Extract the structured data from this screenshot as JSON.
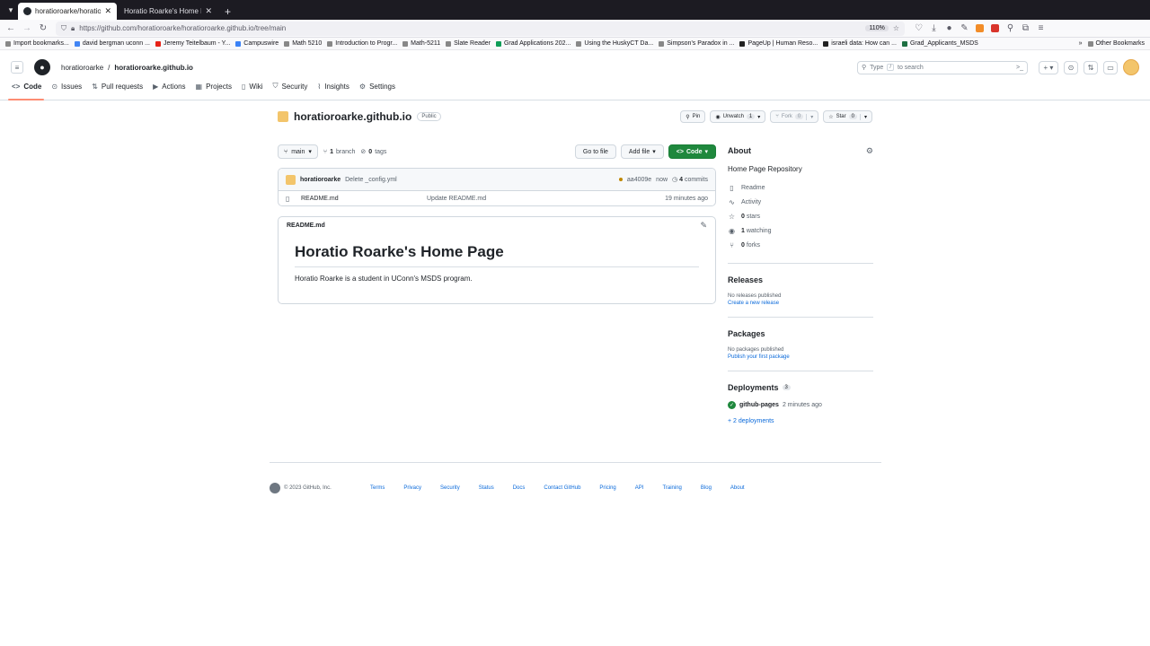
{
  "browser": {
    "tabs": [
      {
        "title": "horatioroarke/horatioroa",
        "active": true
      },
      {
        "title": "Horatio Roarke's Home Page",
        "active": false
      }
    ],
    "url": "https://github.com/horatioroarke/horatioroarke.github.io/tree/main",
    "zoom": "110%",
    "bookmarks": [
      "Import bookmarks...",
      "david bergman uconn ...",
      "Jeremy Teitelbaum - Y...",
      "Campuswire",
      "Math 5210",
      "Introduction to Progr...",
      "Math-5211",
      "Slate Reader",
      "Grad Applications 202...",
      "Using the HuskyCT Da...",
      "Simpson's Paradox in ...",
      "PageUp | Human Reso...",
      "israeli data: How can ...",
      "Grad_Applicants_MSDS"
    ],
    "other_bookmarks": "Other Bookmarks"
  },
  "header": {
    "owner": "horatioroarke",
    "separator": "/",
    "repo": "horatioroarke.github.io",
    "search_placeholder_pre": "Type",
    "search_slash": "/",
    "search_placeholder_post": "to search"
  },
  "repo_nav": [
    {
      "label": "Code",
      "active": true
    },
    {
      "label": "Issues"
    },
    {
      "label": "Pull requests"
    },
    {
      "label": "Actions"
    },
    {
      "label": "Projects"
    },
    {
      "label": "Wiki"
    },
    {
      "label": "Security"
    },
    {
      "label": "Insights"
    },
    {
      "label": "Settings"
    }
  ],
  "repo": {
    "name": "horatioroarke.github.io",
    "visibility": "Public",
    "pin": "Pin",
    "unwatch": "Unwatch",
    "unwatch_count": "1",
    "fork": "Fork",
    "fork_count": "0",
    "star": "Star",
    "star_count": "0"
  },
  "filebar": {
    "branch": "main",
    "branch_count": "1",
    "branch_label": "branch",
    "tag_count": "0",
    "tag_label": "tags",
    "go_to_file": "Go to file",
    "add_file": "Add file",
    "code": "Code"
  },
  "commit": {
    "author": "horatioroarke",
    "message": "Delete _config.yml",
    "sha": "aa4009e",
    "time": "now",
    "commit_count": "4",
    "commit_label": "commits"
  },
  "files": [
    {
      "name": "README.md",
      "message": "Update README.md",
      "time": "19 minutes ago"
    }
  ],
  "readme": {
    "filename": "README.md",
    "heading": "Horatio Roarke's Home Page",
    "body": "Horatio Roarke is a student in UConn's MSDS program."
  },
  "about": {
    "title": "About",
    "description": "Home Page Repository",
    "items": [
      {
        "icon": "book-icon",
        "count": "",
        "label": "Readme"
      },
      {
        "icon": "pulse-icon",
        "count": "",
        "label": "Activity"
      },
      {
        "icon": "star-icon",
        "count": "0",
        "label": "stars"
      },
      {
        "icon": "eye-icon",
        "count": "1",
        "label": "watching"
      },
      {
        "icon": "fork-icon",
        "count": "0",
        "label": "forks"
      }
    ]
  },
  "releases": {
    "title": "Releases",
    "none": "No releases published",
    "create": "Create a new release"
  },
  "packages": {
    "title": "Packages",
    "none": "No packages published",
    "publish": "Publish your first package"
  },
  "deployments": {
    "title": "Deployments",
    "count": "3",
    "env": "github-pages",
    "time": "2 minutes ago",
    "more": "+ 2 deployments"
  },
  "footer": {
    "copyright": "© 2023 GitHub, Inc.",
    "links": [
      "Terms",
      "Privacy",
      "Security",
      "Status",
      "Docs",
      "Contact GitHub",
      "Pricing",
      "API",
      "Training",
      "Blog",
      "About"
    ]
  },
  "colors": {
    "primary_green": "#1f883d",
    "link_blue": "#0969da",
    "active_tab_underline": "#fd8c73",
    "browser_tabbar": "#1c1b22"
  }
}
